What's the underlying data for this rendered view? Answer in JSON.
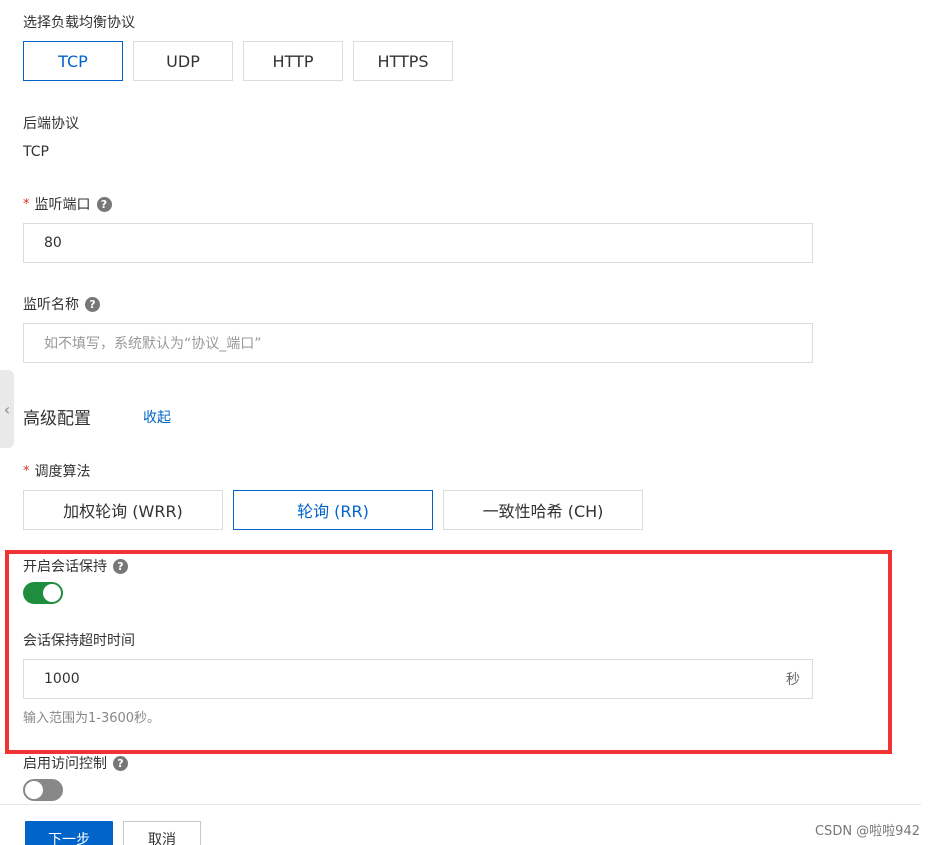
{
  "protocol": {
    "label": "选择负载均衡协议",
    "options": [
      "TCP",
      "UDP",
      "HTTP",
      "HTTPS"
    ],
    "selected": "TCP"
  },
  "backend": {
    "label": "后端协议",
    "value": "TCP"
  },
  "listen_port": {
    "required_mark": "*",
    "label": "监听端口",
    "help": "?",
    "value": "80"
  },
  "listen_name": {
    "label": "监听名称",
    "help": "?",
    "placeholder": "如不填写，系统默认为“协议_端口”"
  },
  "advanced": {
    "title": "高级配置",
    "collapse_link": "收起",
    "side_tab_icon": "chevron-left-icon"
  },
  "scheduler": {
    "required_mark": "*",
    "label": "调度算法",
    "options": [
      "加权轮询 (WRR)",
      "轮询 (RR)",
      "一致性哈希 (CH)"
    ],
    "selected": "轮询 (RR)"
  },
  "session": {
    "label": "开启会话保持",
    "help": "?",
    "enabled": true,
    "timeout_label": "会话保持超时时间",
    "timeout_value": "1000",
    "timeout_unit": "秒",
    "hint": "输入范围为1-3600秒。"
  },
  "access_control": {
    "label": "启用访问控制",
    "help": "?",
    "enabled": false
  },
  "footer": {
    "next_label": "下一步",
    "cancel_label": "取消"
  },
  "watermark": "CSDN @啦啦942",
  "colors": {
    "accent": "#0064c8",
    "toggle_on": "#1e8e3e",
    "highlight": "#f03333"
  }
}
